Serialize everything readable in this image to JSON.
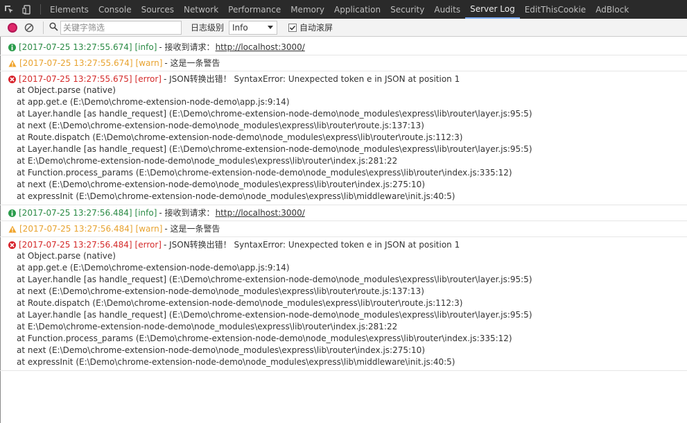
{
  "tabs": [
    "Elements",
    "Console",
    "Sources",
    "Network",
    "Performance",
    "Memory",
    "Application",
    "Security",
    "Audits",
    "Server Log",
    "EditThisCookie",
    "AdBlock"
  ],
  "active_tab": "Server Log",
  "toolbar": {
    "search_placeholder": "关键字筛选",
    "level_label": "日志级别",
    "level_value": "Info",
    "autoscroll_label": "自动滚屏",
    "autoscroll_checked": true
  },
  "colors": {
    "info": "#2a8a44",
    "warn": "#e8a330",
    "error": "#d42a2a",
    "record": "#e0286a",
    "active_tab_underline": "#7cacf8"
  },
  "logs": [
    {
      "level": "info",
      "timestamp": "[2017-07-25 13:27:55.674]",
      "level_tag": "[info]",
      "message": "- 接收到请求：",
      "link": "http://localhost:3000/",
      "stack": []
    },
    {
      "level": "warn",
      "timestamp": "[2017-07-25 13:27:55.674]",
      "level_tag": "[warn]",
      "message": "- 这是一条警告",
      "link": "",
      "stack": []
    },
    {
      "level": "error",
      "timestamp": "[2017-07-25 13:27:55.675]",
      "level_tag": "[error]",
      "message": "- JSON转换出错！ SyntaxError: Unexpected token e in JSON at position 1",
      "link": "",
      "stack": [
        "at Object.parse (native)",
        "at app.get.e (E:\\Demo\\chrome-extension-node-demo\\app.js:9:14)",
        "at Layer.handle [as handle_request] (E:\\Demo\\chrome-extension-node-demo\\node_modules\\express\\lib\\router\\layer.js:95:5)",
        "at next (E:\\Demo\\chrome-extension-node-demo\\node_modules\\express\\lib\\router\\route.js:137:13)",
        "at Route.dispatch (E:\\Demo\\chrome-extension-node-demo\\node_modules\\express\\lib\\router\\route.js:112:3)",
        "at Layer.handle [as handle_request] (E:\\Demo\\chrome-extension-node-demo\\node_modules\\express\\lib\\router\\layer.js:95:5)",
        "at E:\\Demo\\chrome-extension-node-demo\\node_modules\\express\\lib\\router\\index.js:281:22",
        "at Function.process_params (E:\\Demo\\chrome-extension-node-demo\\node_modules\\express\\lib\\router\\index.js:335:12)",
        "at next (E:\\Demo\\chrome-extension-node-demo\\node_modules\\express\\lib\\router\\index.js:275:10)",
        "at expressInit (E:\\Demo\\chrome-extension-node-demo\\node_modules\\express\\lib\\middleware\\init.js:40:5)"
      ]
    },
    {
      "level": "info",
      "timestamp": "[2017-07-25 13:27:56.484]",
      "level_tag": "[info]",
      "message": "- 接收到请求：",
      "link": "http://localhost:3000/",
      "stack": []
    },
    {
      "level": "warn",
      "timestamp": "[2017-07-25 13:27:56.484]",
      "level_tag": "[warn]",
      "message": "- 这是一条警告",
      "link": "",
      "stack": []
    },
    {
      "level": "error",
      "timestamp": "[2017-07-25 13:27:56.484]",
      "level_tag": "[error]",
      "message": "- JSON转换出错！ SyntaxError: Unexpected token e in JSON at position 1",
      "link": "",
      "stack": [
        "at Object.parse (native)",
        "at app.get.e (E:\\Demo\\chrome-extension-node-demo\\app.js:9:14)",
        "at Layer.handle [as handle_request] (E:\\Demo\\chrome-extension-node-demo\\node_modules\\express\\lib\\router\\layer.js:95:5)",
        "at next (E:\\Demo\\chrome-extension-node-demo\\node_modules\\express\\lib\\router\\route.js:137:13)",
        "at Route.dispatch (E:\\Demo\\chrome-extension-node-demo\\node_modules\\express\\lib\\router\\route.js:112:3)",
        "at Layer.handle [as handle_request] (E:\\Demo\\chrome-extension-node-demo\\node_modules\\express\\lib\\router\\layer.js:95:5)",
        "at E:\\Demo\\chrome-extension-node-demo\\node_modules\\express\\lib\\router\\index.js:281:22",
        "at Function.process_params (E:\\Demo\\chrome-extension-node-demo\\node_modules\\express\\lib\\router\\index.js:335:12)",
        "at next (E:\\Demo\\chrome-extension-node-demo\\node_modules\\express\\lib\\router\\index.js:275:10)",
        "at expressInit (E:\\Demo\\chrome-extension-node-demo\\node_modules\\express\\lib\\middleware\\init.js:40:5)"
      ]
    }
  ]
}
